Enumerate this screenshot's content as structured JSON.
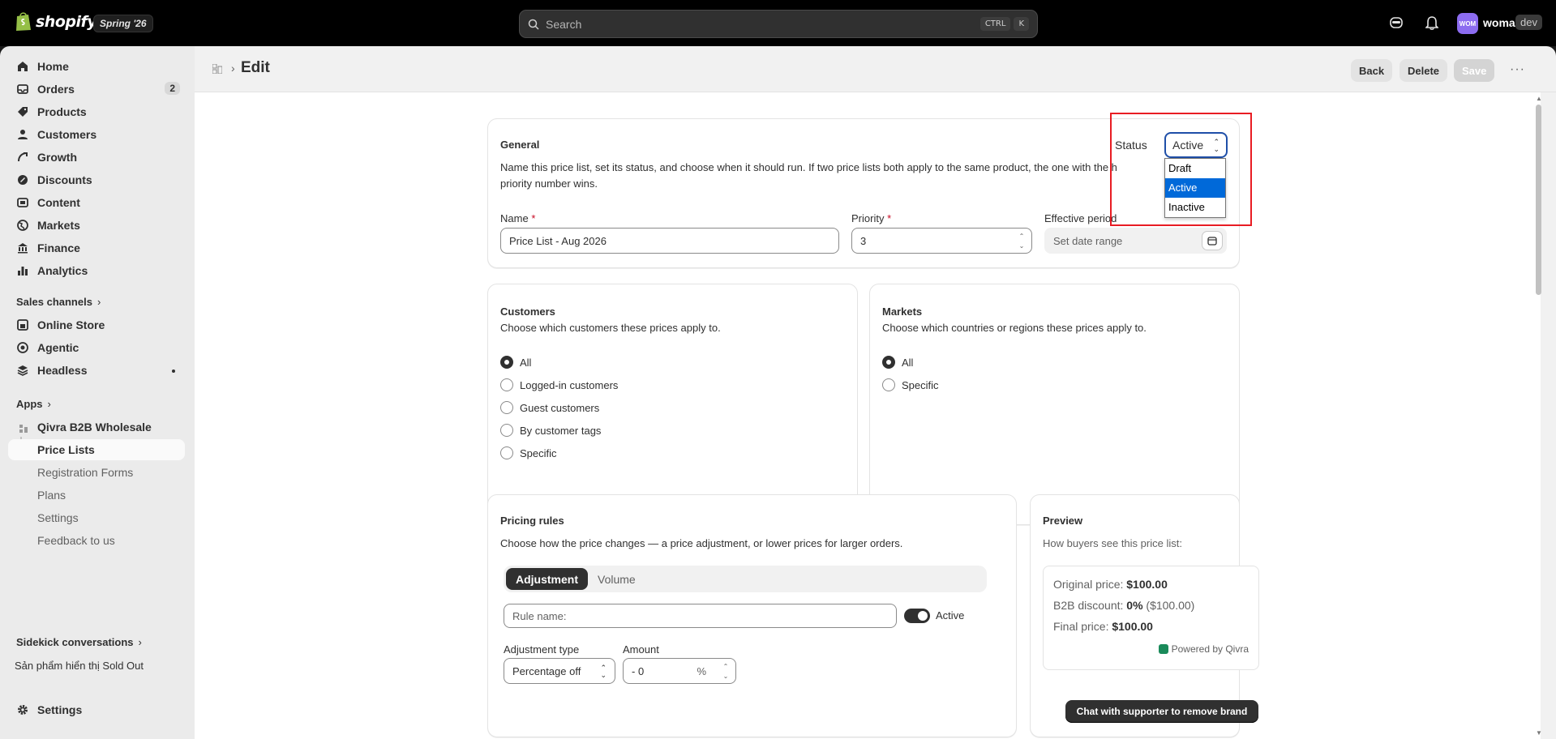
{
  "topbar": {
    "brand": "shopify",
    "edition_badge": "Spring '26",
    "search_placeholder": "Search",
    "search_kbd": [
      "CTRL",
      "K"
    ],
    "avatar_initials": "WOM",
    "user_name": "woma",
    "user_badge": "dev"
  },
  "sidebar": {
    "items": [
      {
        "label": "Home",
        "icon": "home-icon"
      },
      {
        "label": "Orders",
        "icon": "orders-icon",
        "badge": "2"
      },
      {
        "label": "Products",
        "icon": "tag-icon"
      },
      {
        "label": "Customers",
        "icon": "person-icon"
      },
      {
        "label": "Growth",
        "icon": "growth-icon"
      },
      {
        "label": "Discounts",
        "icon": "discount-icon"
      },
      {
        "label": "Content",
        "icon": "content-icon"
      },
      {
        "label": "Markets",
        "icon": "globe-icon"
      },
      {
        "label": "Finance",
        "icon": "bank-icon"
      },
      {
        "label": "Analytics",
        "icon": "bar-chart-icon"
      }
    ],
    "sales_channels_label": "Sales channels",
    "channels": [
      {
        "label": "Online Store",
        "icon": "store-icon"
      },
      {
        "label": "Agentic",
        "icon": "agentic-icon"
      },
      {
        "label": "Headless",
        "icon": "headless-icon"
      }
    ],
    "apps_label": "Apps",
    "app_name": "Qivra B2B Wholesale",
    "app_pages": [
      "Price Lists",
      "Registration Forms",
      "Plans",
      "Settings",
      "Feedback to us"
    ],
    "sidekick_label": "Sidekick conversations",
    "sidekick_item": "Sản phẩm hiển thị Sold Out",
    "settings_label": "Settings"
  },
  "header": {
    "title": "Edit",
    "back": "Back",
    "delete": "Delete",
    "save": "Save",
    "more": "···"
  },
  "general": {
    "title": "General",
    "status_label": "Status",
    "status_value": "Active",
    "status_options": [
      "Draft",
      "Active",
      "Inactive"
    ],
    "description_line1": "Name this price list, set its status, and choose when it should run. If two price lists both apply to the same product, the one with the h",
    "description_line2": "priority number wins.",
    "name_label": "Name",
    "name_value": "Price List - Aug 2026",
    "priority_label": "Priority",
    "priority_value": "3",
    "period_label": "Effective period",
    "period_placeholder": "Set date range",
    "required_mark": "*"
  },
  "customers": {
    "title": "Customers",
    "description": "Choose which customers these prices apply to.",
    "options": [
      "All",
      "Logged-in customers",
      "Guest customers",
      "By customer tags",
      "Specific"
    ],
    "selected_index": 0
  },
  "markets": {
    "title": "Markets",
    "description": "Choose which countries or regions these prices apply to.",
    "options": [
      "All",
      "Specific"
    ],
    "selected_index": 0
  },
  "pricing": {
    "title": "Pricing rules",
    "description": "Choose how the price changes — a price adjustment, or lower prices for larger orders.",
    "tabs": [
      "Adjustment",
      "Volume"
    ],
    "rule_name_placeholder": "Rule name:",
    "active_label": "Active",
    "adjustment_type_label": "Adjustment type",
    "adjustment_type_value": "Percentage off",
    "amount_label": "Amount",
    "amount_value": "- 0",
    "amount_unit": "%"
  },
  "preview": {
    "title": "Preview",
    "description": "How buyers see this price list:",
    "original_label": "Original price:",
    "original_value": "$100.00",
    "discount_label": "B2B discount:",
    "discount_value": "0%",
    "discount_amount": "($100.00)",
    "final_label": "Final price:",
    "final_value": "$100.00",
    "powered_by": "Powered by Qivra",
    "cta": "Chat with supporter to remove brand"
  },
  "colors": {
    "topbar": "#000000",
    "sidebar": "#ebebeb",
    "highlight": "#e81c23",
    "select_focus": "#1f4fa8",
    "dropdown_selected": "#0069d9"
  }
}
